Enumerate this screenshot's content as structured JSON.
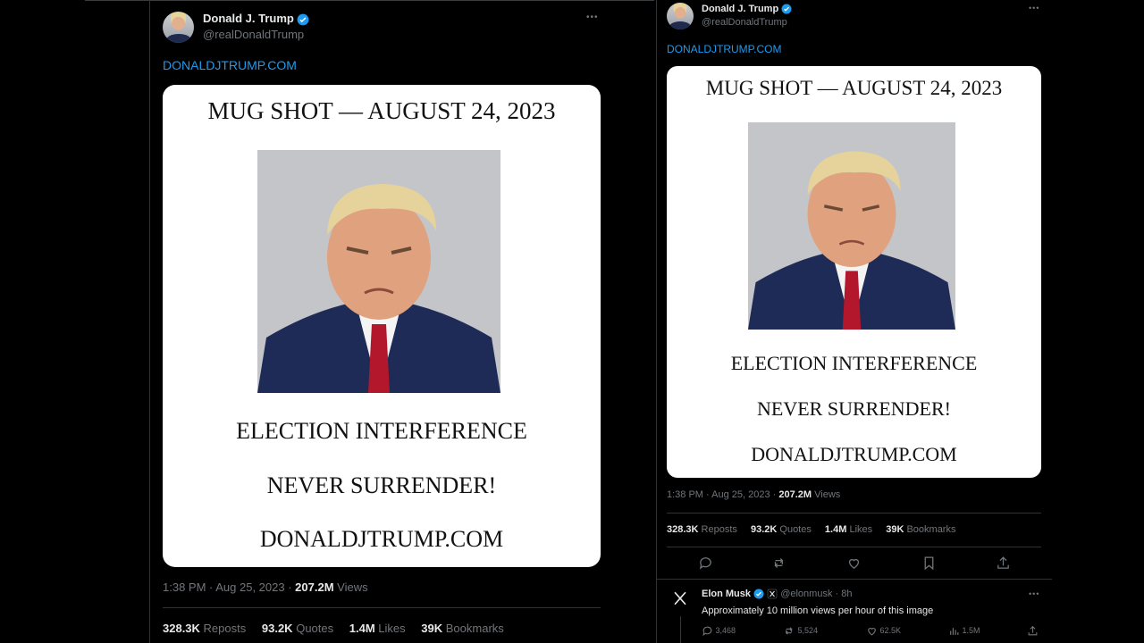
{
  "tweet": {
    "author_name": "Donald J. Trump",
    "author_handle": "@realDonaldTrump",
    "link_text": "DONALDJTRUMP.COM",
    "more_glyph": "•••",
    "card": {
      "line1": "MUG SHOT — AUGUST 24, 2023",
      "line2": "ELECTION INTERFERENCE",
      "line3": "NEVER SURRENDER!",
      "line4": "DONALDJTRUMP.COM"
    },
    "time": "1:38 PM · Aug 25, 2023 ·",
    "views_count": "207.2M",
    "views_label": "Views",
    "stats": [
      {
        "value": "328.3K",
        "label": "Reposts"
      },
      {
        "value": "93.2K",
        "label": "Quotes"
      },
      {
        "value": "1.4M",
        "label": "Likes"
      },
      {
        "value": "39K",
        "label": "Bookmarks"
      }
    ]
  },
  "reply": {
    "author_name": "Elon Musk",
    "author_handle": "@elonmusk",
    "age": "· 8h",
    "text": "Approximately 10 million views per hour of this image",
    "actions": [
      {
        "icon": "reply-icon",
        "value": "3,468"
      },
      {
        "icon": "repost-icon",
        "value": "5,524"
      },
      {
        "icon": "like-icon",
        "value": "62.5K"
      },
      {
        "icon": "views-icon",
        "value": "1.5M"
      }
    ]
  },
  "colors": {
    "background": "#000000",
    "accent": "#1d9bf0",
    "muted": "#71767b",
    "border": "#2f3336"
  }
}
